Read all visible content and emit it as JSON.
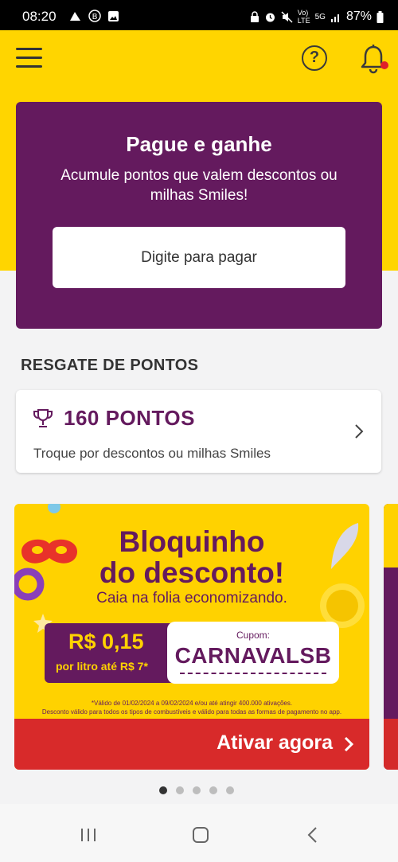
{
  "status_bar": {
    "time": "08:20",
    "battery": "87%",
    "network": "5G"
  },
  "header": {
    "menu_icon": "hamburger-menu-icon",
    "help_icon": "help-circle-icon",
    "help_symbol": "?",
    "bell_icon": "bell-icon"
  },
  "pay_card": {
    "title": "Pague e ganhe",
    "subtitle": "Acumule pontos que valem descontos ou milhas Smiles!",
    "input_placeholder": "Digite para pagar"
  },
  "rewards": {
    "section_title": "RESGATE DE PONTOS",
    "points": "160 PONTOS",
    "description": "Troque por descontos ou milhas Smiles"
  },
  "banner": {
    "title_line1": "Bloquinho",
    "title_line2": "do desconto!",
    "subtitle": "Caia na folia economizando.",
    "price": "R$ 0,15",
    "price_detail": "por litro até R$ 7*",
    "coupon_label": "Cupom:",
    "coupon_code": "CARNAVALSB",
    "disclaimer_line1": "*Válido de 01/02/2024 a 09/02/2024 e/ou até atingir 400.000 ativações.",
    "disclaimer_line2": "Desconto válido para todos os tipos de combustíveis e válido para todas as formas de pagamento no app.",
    "cta_label": "Ativar agora"
  },
  "carousel": {
    "total": 5,
    "active_index": 0
  },
  "colors": {
    "brand_yellow": "#ffd500",
    "brand_purple": "#641a5e",
    "cta_red": "#d82a2a"
  }
}
